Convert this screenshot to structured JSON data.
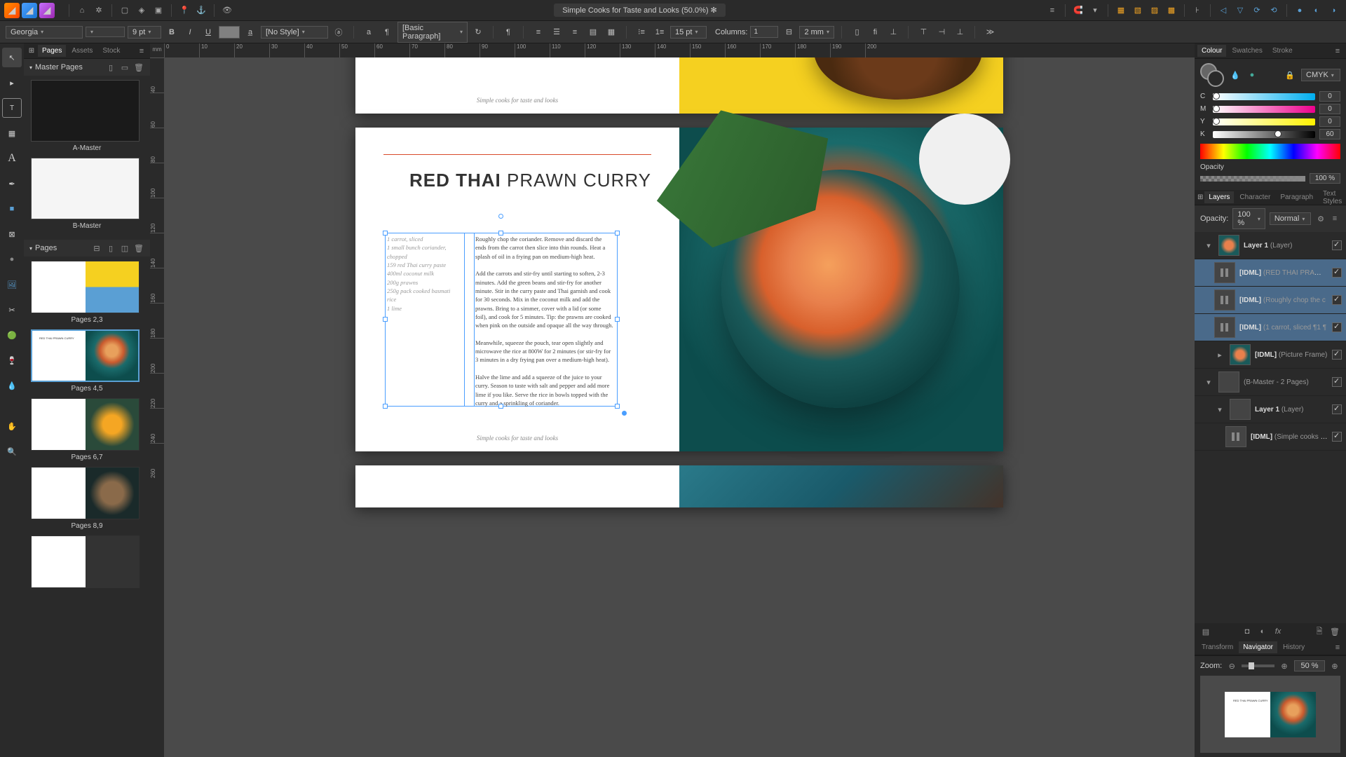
{
  "docTitle": "Simple Cooks for Taste and Looks (50.0%) ✻",
  "font": {
    "family": "Georgia",
    "style": "",
    "size": "9 pt",
    "paraStyle": "[No Style]",
    "baseParagraph": "[Basic Paragraph]",
    "leading": "15 pt",
    "columnsLabel": "Columns:",
    "columnsVal": "1",
    "gutter": "2 mm"
  },
  "rulerUnit": "mm",
  "pagesPanel": {
    "tabs": [
      "Pages",
      "Assets",
      "Stock"
    ],
    "masterHeader": "Master Pages",
    "pagesHeader": "Pages",
    "masters": [
      {
        "name": "A-Master"
      },
      {
        "name": "B-Master"
      }
    ],
    "spreads": [
      {
        "label": "Pages 2,3"
      },
      {
        "label": "Pages 4,5"
      },
      {
        "label": "Pages 6,7"
      },
      {
        "label": "Pages 8,9"
      }
    ],
    "selectedSpread": 1
  },
  "recipe": {
    "titleBold": "RED THAI",
    "titleLight": " PRAWN CURRY",
    "footer": "Simple cooks for taste and looks",
    "ingredients": "1 carrot, sliced\n1 small bunch coriander, chopped\n159 red Thai curry paste\n400ml coconut milk\n200g prawns\n250g pack cooked basmati rice\n1 lime",
    "method": "Roughly chop the coriander. Remove and discard the ends from the carrot then slice into thin rounds. Heat a splash of oil in a frying pan on medium-high heat.\n\nAdd the carrots and stir-fry until starting to soften, 2-3 minutes. Add the green beans and stir-fry for another minute. Stir in the curry paste and Thai garnish and cook for 30 seconds. Mix in the coconut milk and add the prawns. Bring to a simmer, cover with a lid (or some foil), and cook for 5 minutes. Tip: the prawns are cooked when pink on the outside and opaque all the way through.\n\nMeanwhile, squeeze the pouch, tear open slightly and microwave the rice at 800W for 2 minutes (or stir-fry for 3 minutes in a dry frying pan over a medium-high heat).\n\nHalve the lime and add a squeeze of the juice to your curry. Season to taste with salt and pepper and add more lime if you like. Serve the rice in bowls topped with the curry and a sprinkling of coriander."
  },
  "colorPanel": {
    "tabs": [
      "Colour",
      "Swatches",
      "Stroke"
    ],
    "model": "CMYK",
    "channels": [
      [
        "C",
        0
      ],
      [
        "M",
        0
      ],
      [
        "Y",
        0
      ],
      [
        "K",
        60
      ]
    ],
    "opacityLabel": "Opacity",
    "opacity": "100 %"
  },
  "layersPanel": {
    "tabs": [
      "Layers",
      "Character",
      "Paragraph",
      "Text Styles"
    ],
    "opacityLabel": "Opacity:",
    "opacity": "100 %",
    "blend": "Normal",
    "layers": [
      {
        "indent": 0,
        "name": "Layer 1",
        "type": "(Layer)",
        "thumb": "img",
        "sel": false,
        "arrow": "down"
      },
      {
        "indent": 1,
        "name": "[IDML]",
        "type": "(RED THAI PRAWN C",
        "thumb": "txt",
        "sel": true
      },
      {
        "indent": 1,
        "name": "[IDML]",
        "type": "(Roughly chop the c",
        "thumb": "txt",
        "sel": true
      },
      {
        "indent": 1,
        "name": "[IDML]",
        "type": "(1 carrot, sliced  ¶1 ¶",
        "thumb": "txt",
        "sel": true
      },
      {
        "indent": 1,
        "name": "[IDML]",
        "type": "(Picture Frame)",
        "thumb": "img",
        "sel": false,
        "arrow": "right"
      },
      {
        "indent": 0,
        "name": "",
        "type": "(B-Master - 2 Pages)",
        "thumb": "blank",
        "sel": false,
        "arrow": "down"
      },
      {
        "indent": 1,
        "name": "Layer 1",
        "type": "(Layer)",
        "thumb": "blank",
        "sel": false,
        "arrow": "down"
      },
      {
        "indent": 2,
        "name": "[IDML]",
        "type": "(Simple cooks for",
        "thumb": "txt",
        "sel": false
      }
    ]
  },
  "navPanel": {
    "tabs": [
      "Transform",
      "Navigator",
      "History"
    ],
    "zoomLabel": "Zoom:",
    "zoom": "50 %"
  }
}
